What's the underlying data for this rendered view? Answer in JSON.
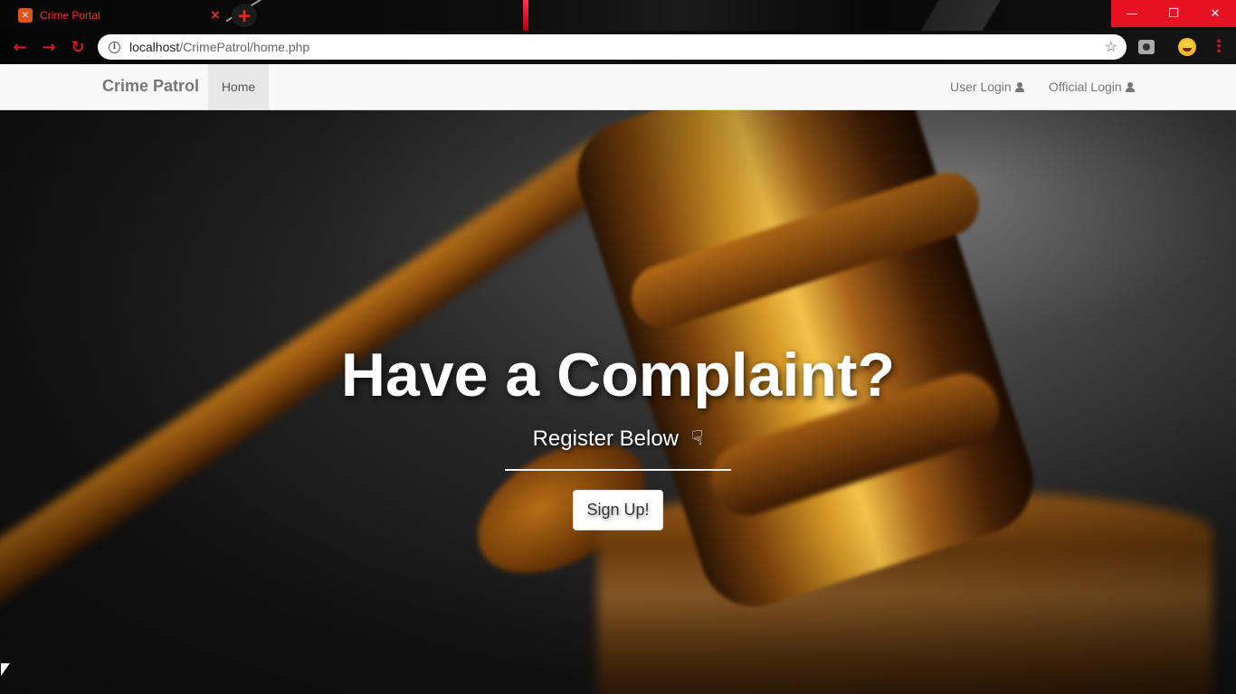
{
  "browser": {
    "tab_title": "Crime Portal",
    "tab_favicon": "xampp-icon",
    "tab_close": "×",
    "new_tab": "+",
    "url_host": "localhost",
    "url_path": "/CrimePatrol/home.php",
    "window": {
      "minimize": "—",
      "maximize": "❐",
      "close": "✕"
    },
    "accent_color": "#e81123"
  },
  "navbar": {
    "brand": "Crime Patrol",
    "home": "Home",
    "user_login": "User Login",
    "official_login": "Official Login"
  },
  "hero": {
    "title": "Have a Complaint?",
    "subtitle": "Register Below",
    "subtitle_icon": "hand-down-icon",
    "signup_label": "Sign Up!"
  }
}
